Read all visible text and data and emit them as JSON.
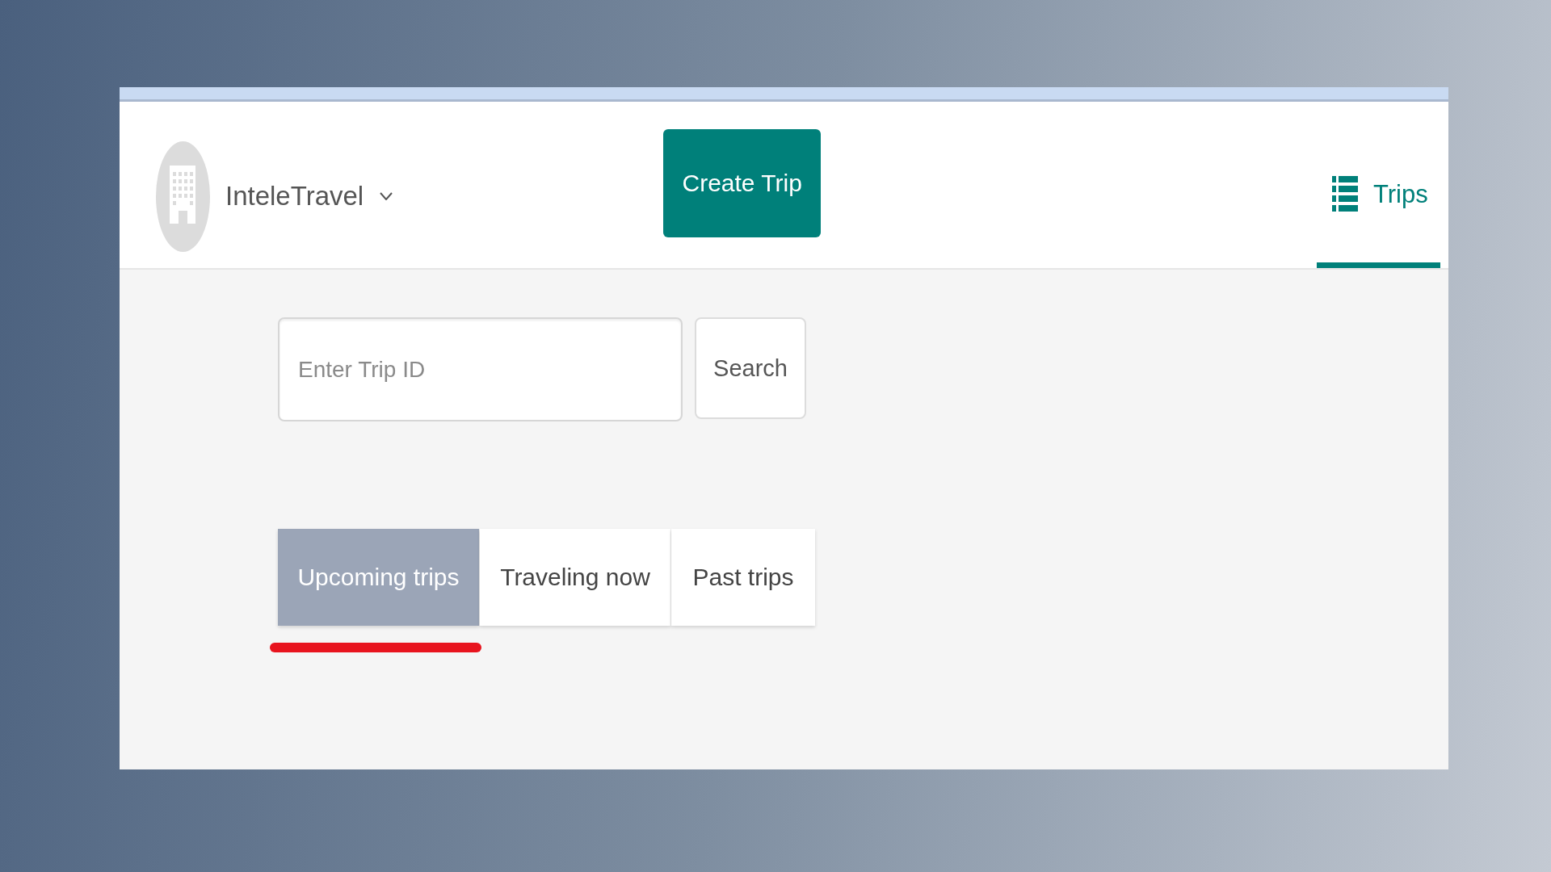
{
  "header": {
    "brand": {
      "name": "InteleTravel"
    },
    "create_button": {
      "label": "Create Trip"
    },
    "nav": [
      {
        "label": "Trips",
        "selected": true
      }
    ]
  },
  "search": {
    "placeholder": "Enter Trip ID",
    "button": "Search"
  },
  "tabs": [
    {
      "label": "Upcoming trips",
      "selected": true,
      "underlined": true
    },
    {
      "label": "Traveling now",
      "selected": false,
      "underlined": false
    },
    {
      "label": "Past trips",
      "selected": false,
      "underlined": false
    }
  ]
}
